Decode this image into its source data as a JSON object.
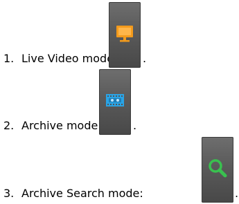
{
  "items": [
    {
      "number": "1.",
      "label": "Live Video mode",
      "icon": "monitor-icon",
      "icon_color": "#f39a1c",
      "suffix": "."
    },
    {
      "number": "2.",
      "label": "Archive mode:",
      "icon": "film-tape-icon",
      "icon_color": "#2aa4e6",
      "suffix": "."
    },
    {
      "number": "3.",
      "label": "Archive Search mode:",
      "icon": "magnifier-icon",
      "icon_color": "#39c14f",
      "suffix": "."
    }
  ]
}
